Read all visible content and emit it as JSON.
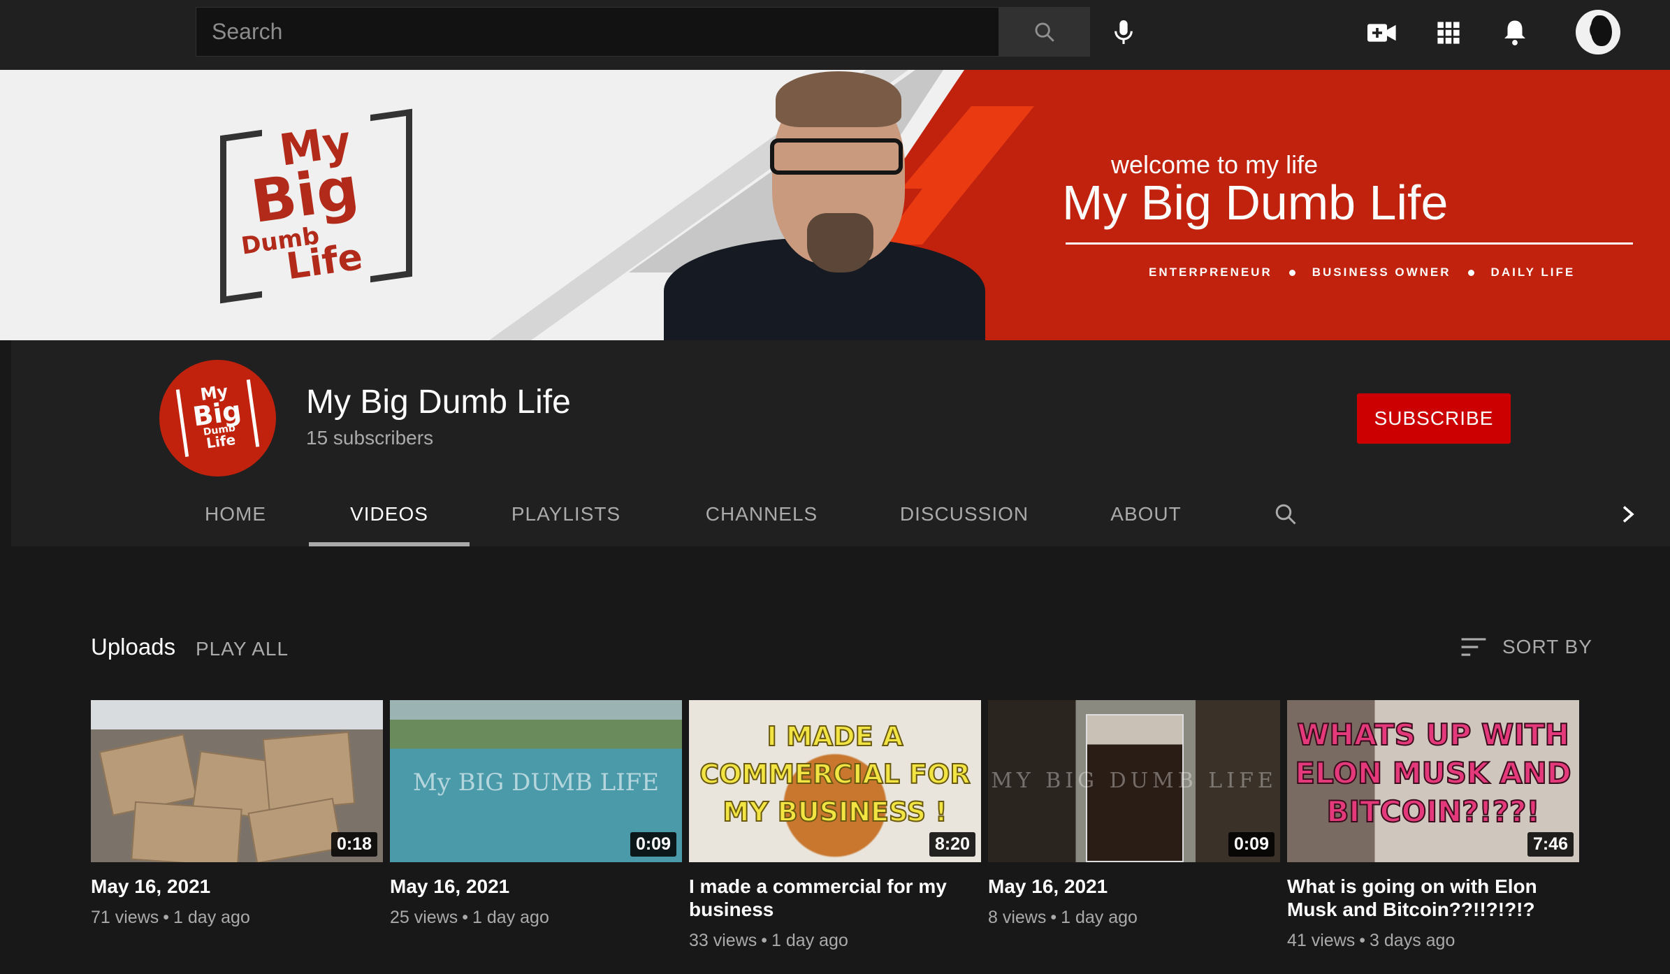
{
  "search": {
    "placeholder": "Search"
  },
  "icons": {
    "search": "search-icon",
    "mic": "mic-icon",
    "create": "video-camera-plus-icon",
    "apps": "apps-grid-icon",
    "notifications": "bell-icon",
    "tab_search": "search-icon",
    "tab_next": "chevron-right-icon",
    "sort": "sort-icon"
  },
  "colors": {
    "topbar": "#202020",
    "background": "#181818",
    "subscribe": "#cc0000",
    "banner_red": "#c1220e"
  },
  "banner": {
    "logo_words": [
      "My",
      "Big",
      "Dumb",
      "Life"
    ],
    "welcome": "welcome to my life",
    "title": "My Big Dumb Life",
    "tag1": "ENTERPRENEUR",
    "tag2": "BUSINESS OWNER",
    "tag3": "DAILY LIFE"
  },
  "channel": {
    "name": "My Big Dumb Life",
    "subscribers": "15 subscribers",
    "subscribe_label": "SUBSCRIBE"
  },
  "tabs": [
    {
      "label": "HOME"
    },
    {
      "label": "VIDEOS"
    },
    {
      "label": "PLAYLISTS"
    },
    {
      "label": "CHANNELS"
    },
    {
      "label": "DISCUSSION"
    },
    {
      "label": "ABOUT"
    }
  ],
  "uploads": {
    "label": "Uploads",
    "play_all": "PLAY ALL",
    "sort_by": "SORT BY"
  },
  "videos": [
    {
      "title": "May 16, 2021",
      "duration": "0:18",
      "views": "71 views",
      "age": "1 day ago"
    },
    {
      "title": "May 16, 2021",
      "duration": "0:09",
      "views": "25 views",
      "age": "1 day ago",
      "thumb_text": "My BIG DUMB LIFE"
    },
    {
      "title": "I made a commercial for my business",
      "duration": "8:20",
      "views": "33 views",
      "age": "1 day ago",
      "thumb_text": "I MADE A COMMERCIAL FOR MY BUSINESS !"
    },
    {
      "title": "May 16, 2021",
      "duration": "0:09",
      "views": "8 views",
      "age": "1 day ago",
      "thumb_text": "MY BIG DUMB LIFE"
    },
    {
      "title": "What is going on with Elon Musk and Bitcoin??!!?!?!?",
      "duration": "7:46",
      "views": "41 views",
      "age": "3 days ago",
      "thumb_text": "WHATS UP WITH ELON MUSK AND BITCOIN?!??!"
    }
  ],
  "separator": "•"
}
